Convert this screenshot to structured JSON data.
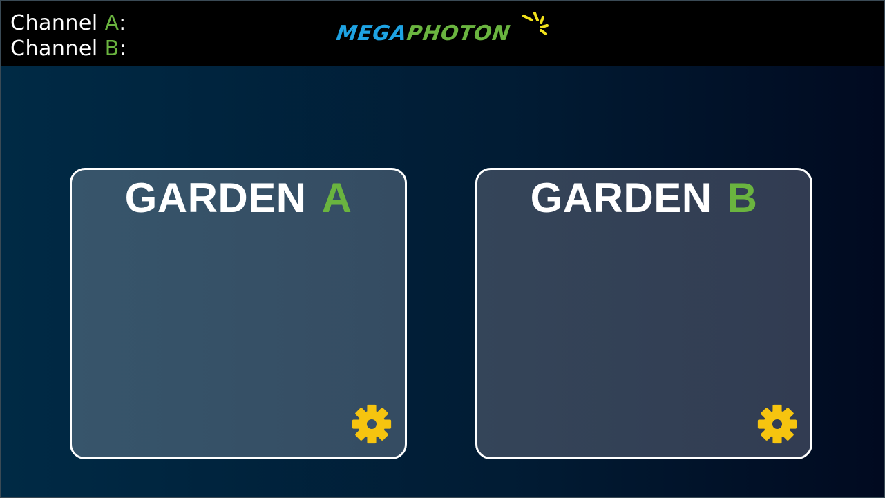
{
  "colors": {
    "accent_green": "#6ab43f",
    "logo_blue": "#1ea3e3",
    "gear_yellow": "#f6c40f",
    "white": "#ffffff"
  },
  "header": {
    "channel_a": {
      "label": "Channel",
      "letter": "A",
      "suffix": ":"
    },
    "channel_b": {
      "label": "Channel",
      "letter": "B",
      "suffix": ":"
    },
    "logo": {
      "part1": "MEGA",
      "part2": "PHOTON",
      "icon": "sun-rays-icon"
    }
  },
  "gardens": [
    {
      "label": "GARDEN",
      "letter": "A",
      "settings_icon": "gear-icon"
    },
    {
      "label": "GARDEN",
      "letter": "B",
      "settings_icon": "gear-icon"
    }
  ]
}
